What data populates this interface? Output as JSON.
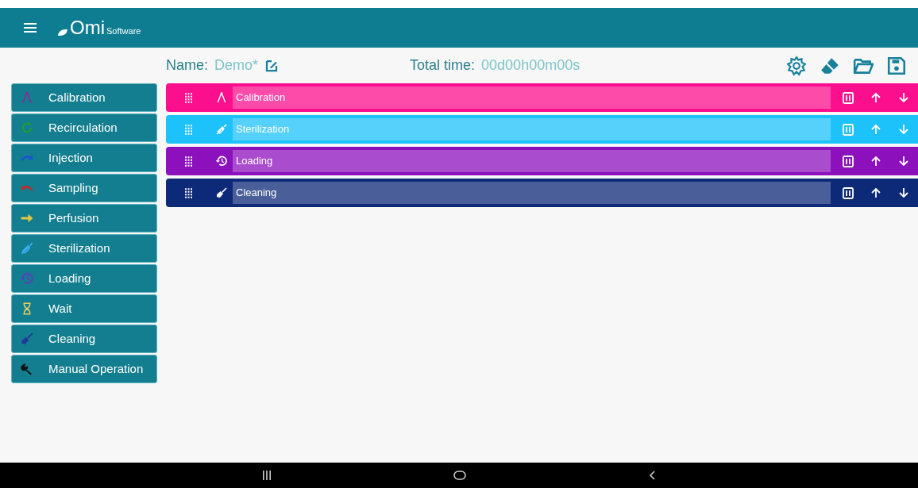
{
  "header": {
    "logo": {
      "name": "Omi",
      "suffix": "Software"
    }
  },
  "toolbar": {
    "name_label": "Name:",
    "name_value": "Demo*",
    "time_label": "Total time:",
    "time_value": "00d00h00m00s"
  },
  "sidebar": {
    "items": [
      {
        "label": "Calibration",
        "kind": "calibration",
        "color": "#8e2a9c"
      },
      {
        "label": "Recirculation",
        "kind": "recirculation",
        "color": "#1a9e3a"
      },
      {
        "label": "Injection",
        "kind": "injection",
        "color": "#1a4fd8"
      },
      {
        "label": "Sampling",
        "kind": "sampling",
        "color": "#d42020"
      },
      {
        "label": "Perfusion",
        "kind": "perfusion",
        "color": "#e2c642"
      },
      {
        "label": "Sterilization",
        "kind": "sterilization",
        "color": "#3ab0f0"
      },
      {
        "label": "Loading",
        "kind": "loading",
        "color": "#5a3fc0"
      },
      {
        "label": "Wait",
        "kind": "wait",
        "color": "#e6d060"
      },
      {
        "label": "Cleaning",
        "kind": "cleaning",
        "color": "#1f3a9a"
      },
      {
        "label": "Manual Operation",
        "kind": "manual",
        "color": "#111111"
      }
    ]
  },
  "steps": [
    {
      "label": "Calibration",
      "kind": "calibration",
      "color": "#fc0f8d"
    },
    {
      "label": "Sterilization",
      "kind": "sterilization",
      "color": "#1ec2fa"
    },
    {
      "label": "Loading",
      "kind": "loading",
      "color": "#8d10bd"
    },
    {
      "label": "Cleaning",
      "kind": "cleaning",
      "color": "#0d2a78"
    }
  ]
}
